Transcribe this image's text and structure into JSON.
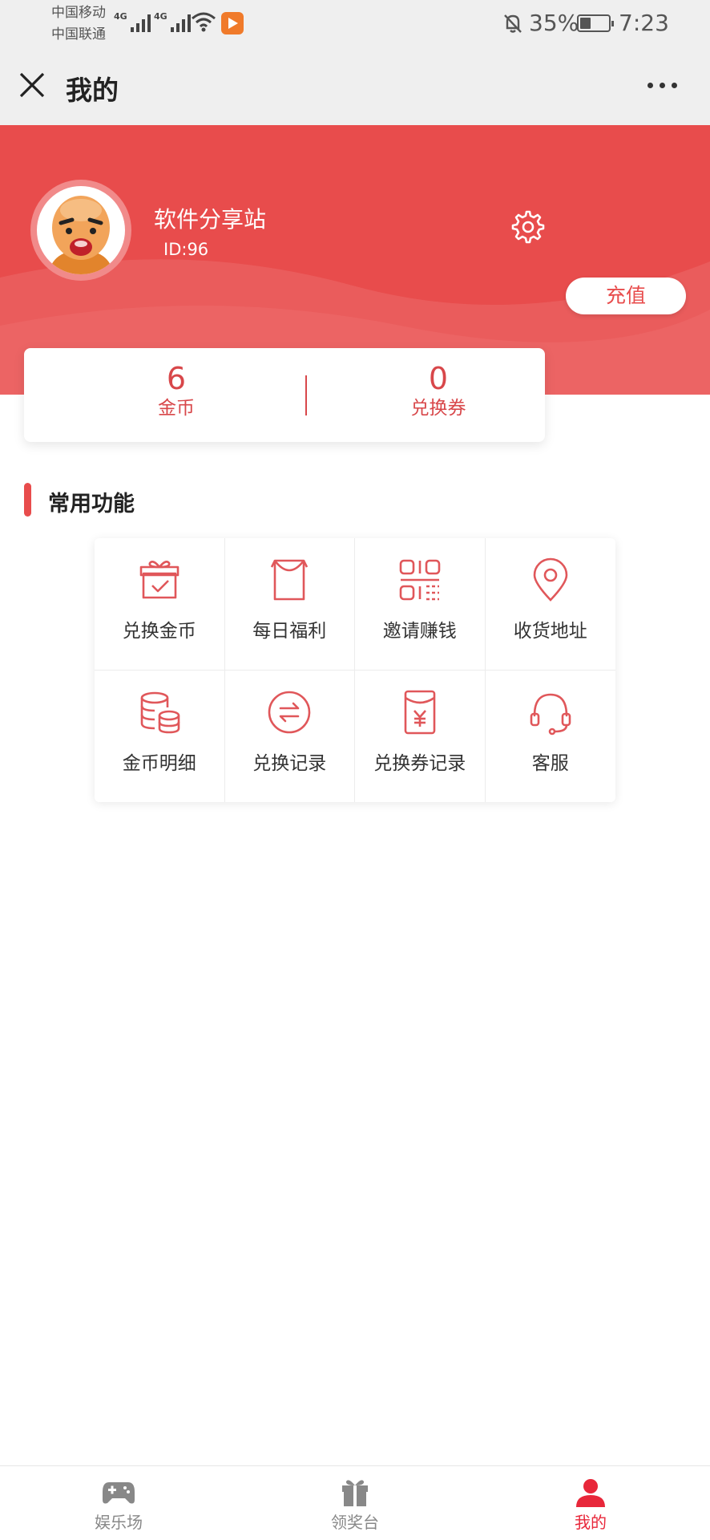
{
  "status_bar": {
    "carrier1": "中国移动",
    "carrier2": "中国联通",
    "network1": "4G",
    "network2": "4G",
    "battery": "35%",
    "battery_level": 0.35,
    "time": "7:23"
  },
  "navbar": {
    "title": "我的",
    "close_icon": "close-icon",
    "more_icon": "more-dots-icon"
  },
  "profile": {
    "name": "软件分享站",
    "id": "ID:96",
    "recharge_label": "充值",
    "settings_icon": "gear-icon"
  },
  "stats": [
    {
      "value": "6",
      "label": "金币"
    },
    {
      "value": "0",
      "label": "兑换券"
    }
  ],
  "section": {
    "title": "常用功能"
  },
  "functions": [
    {
      "label": "兑换金币",
      "icon": "gift-box-icon"
    },
    {
      "label": "每日福利",
      "icon": "bag-icon"
    },
    {
      "label": "邀请赚钱",
      "icon": "qr-code-icon"
    },
    {
      "label": "收货地址",
      "icon": "location-pin-icon"
    },
    {
      "label": "金币明细",
      "icon": "coin-stack-icon"
    },
    {
      "label": "兑换记录",
      "icon": "exchange-icon"
    },
    {
      "label": "兑换券记录",
      "icon": "voucher-icon"
    },
    {
      "label": "客服",
      "icon": "headset-icon"
    }
  ],
  "tabs": [
    {
      "label": "娱乐场",
      "icon": "gamepad-icon",
      "active": false
    },
    {
      "label": "领奖台",
      "icon": "gift-icon",
      "active": false
    },
    {
      "label": "我的",
      "icon": "user-icon",
      "active": true
    }
  ],
  "colors": {
    "accent": "#e84c4c",
    "stat_text": "#d8474a",
    "active_tab": "#e8273a",
    "inactive_tab": "#888888"
  }
}
